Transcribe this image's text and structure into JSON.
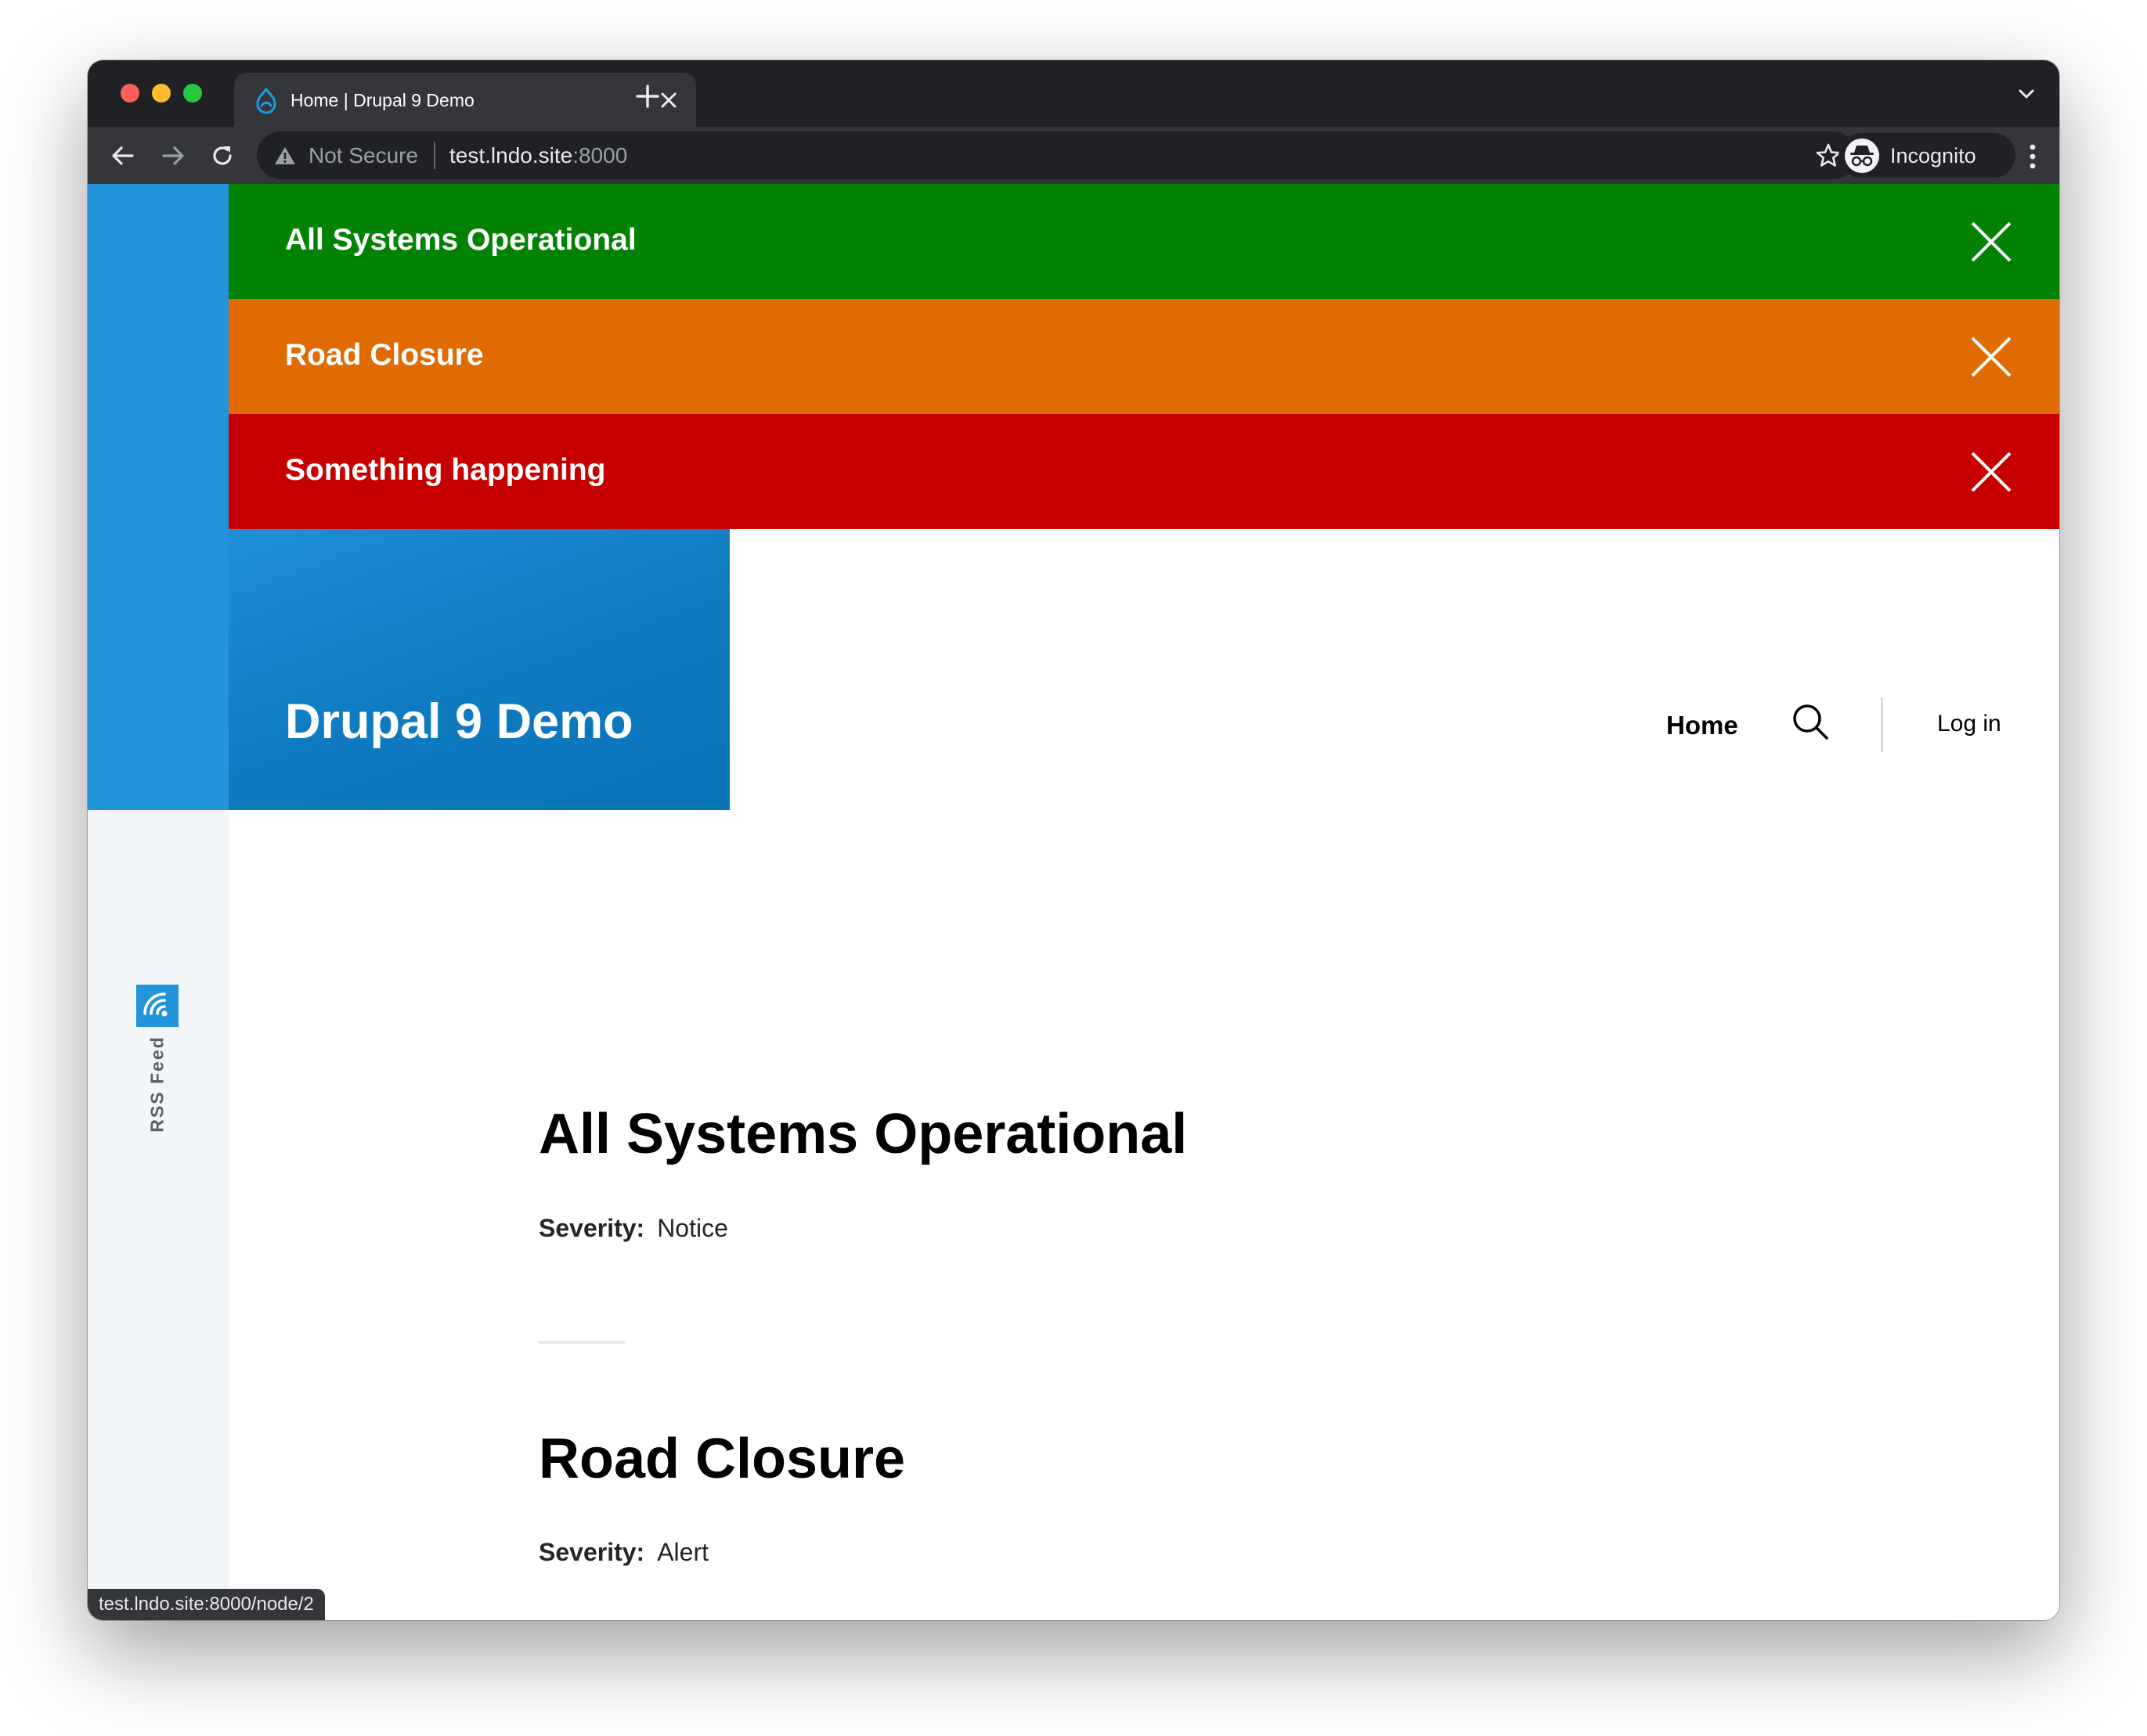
{
  "browser": {
    "tab_title": "Home | Drupal 9 Demo",
    "security_label": "Not Secure",
    "url_host": "test.lndo.site",
    "url_port": ":8000",
    "profile_label": "Incognito",
    "status_url": "test.lndo.site:8000/node/2"
  },
  "alerts": [
    {
      "label": "All Systems Operational",
      "color": "#028202"
    },
    {
      "label": "Road Closure",
      "color": "#e06b00"
    },
    {
      "label": "Something happening",
      "color": "#c60000"
    }
  ],
  "site": {
    "name": "Drupal 9 Demo",
    "brand_color": "#2394dc"
  },
  "nav": {
    "home": "Home",
    "login": "Log in",
    "search_icon": "search-icon"
  },
  "sidebar": {
    "rss_label": "RSS Feed",
    "rss_icon": "rss-icon"
  },
  "articles": [
    {
      "title": "All Systems Operational",
      "severity_label": "Severity:",
      "severity_value": "Notice"
    },
    {
      "title": "Road Closure",
      "severity_label": "Severity:",
      "severity_value": "Alert"
    }
  ]
}
